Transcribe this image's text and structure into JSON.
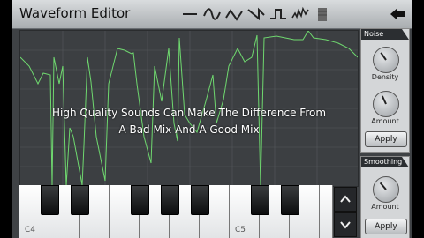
{
  "app": {
    "title": "Waveform Editor"
  },
  "toolbar": {
    "tools": [
      {
        "name": "flat-line-icon"
      },
      {
        "name": "sine-wave-icon"
      },
      {
        "name": "triangle-wave-icon"
      },
      {
        "name": "sawtooth-wave-icon"
      },
      {
        "name": "square-wave-icon"
      },
      {
        "name": "noise-wave-icon"
      },
      {
        "name": "sample-icon"
      }
    ],
    "back": {
      "name": "back-arrow-icon"
    }
  },
  "caption": {
    "line1": "High Quality Sounds Can Make The Difference From",
    "line2": "A Bad Mix And A Good Mix"
  },
  "noise_panel": {
    "title": "Noise",
    "density_label": "Density",
    "amount_label": "Amount",
    "apply_label": "Apply"
  },
  "smoothing_panel": {
    "title": "Smoothing",
    "amount_label": "Amount",
    "apply_label": "Apply"
  },
  "keyboard": {
    "label_c4": "C4",
    "label_c5": "C5"
  },
  "colors": {
    "waveform": "#6fd86f",
    "background": "#3f4245"
  }
}
